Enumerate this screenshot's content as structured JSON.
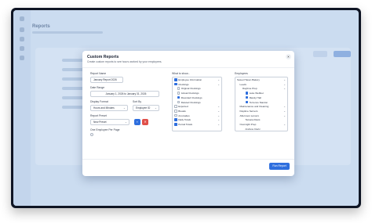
{
  "background": {
    "page_title": "Reports"
  },
  "dialog": {
    "title": "Custom Reports",
    "subtitle": "Create custom reports to see hours worked by your employees.",
    "close_glyph": "×",
    "report_name": {
      "label": "Report Name",
      "value": "January Report 2026"
    },
    "date_range": {
      "label": "Date Range",
      "value": "January 1, 2026 to January 31, 2026"
    },
    "display_format": {
      "label": "Display Format",
      "value": "Hours and Minutes"
    },
    "sort_by": {
      "label": "Sort By",
      "value": "Employee ID"
    },
    "report_preset": {
      "label": "Report Preset",
      "value": "New Preset"
    },
    "one_employee_per_page": {
      "label": "One Employee Per Page",
      "checked": false
    },
    "what_to_show": {
      "label": "What to show...",
      "items": [
        {
          "label": "Employee Information",
          "checked": true,
          "indent": 0,
          "expandable": true
        },
        {
          "label": "Clockings",
          "checked": true,
          "indent": 0,
          "expandable": true
        },
        {
          "label": "Original Clockings",
          "checked": false,
          "indent": 1,
          "expandable": false
        },
        {
          "label": "Actual Clockings",
          "checked": false,
          "indent": 1,
          "expandable": false
        },
        {
          "label": "Rounded Clockings",
          "checked": true,
          "indent": 1,
          "expandable": false
        },
        {
          "label": "Deleted Clockings",
          "checked": false,
          "indent": 1,
          "expandable": false
        },
        {
          "label": "Exported",
          "checked": false,
          "indent": 0,
          "expandable": true
        },
        {
          "label": "Breaks",
          "checked": false,
          "indent": 0,
          "expandable": true
        },
        {
          "label": "Anomalies",
          "checked": false,
          "indent": 0,
          "expandable": true
        },
        {
          "label": "Daily Totals",
          "checked": true,
          "indent": 0,
          "expandable": true
        },
        {
          "label": "Period Totals",
          "checked": true,
          "indent": 0,
          "expandable": true
        }
      ]
    },
    "employees": {
      "label": "Employees",
      "items": [
        {
          "label": "Sweet Haven Bakery",
          "checkbox": null,
          "indent": 0,
          "expandable": true
        },
        {
          "label": "Leeds",
          "checkbox": null,
          "indent": 1,
          "expandable": true
        },
        {
          "label": "Daytime Prep",
          "checkbox": null,
          "indent": 2,
          "expandable": true
        },
        {
          "label": "Luke Webber",
          "checkbox": true,
          "indent": 3,
          "expandable": false
        },
        {
          "label": "Randy Hall",
          "checkbox": true,
          "indent": 3,
          "expandable": false
        },
        {
          "label": "Terrence Stanton",
          "checkbox": true,
          "indent": 3,
          "expandable": false
        },
        {
          "label": "Maintenance and Cleaning",
          "checkbox": null,
          "indent": 1,
          "expandable": true
        },
        {
          "label": "Daytime Servers",
          "checkbox": null,
          "indent": 1,
          "expandable": true
        },
        {
          "label": "Afternoon servers",
          "checkbox": null,
          "indent": 1,
          "expandable": true
        },
        {
          "label": "Tamara Davis",
          "checkbox": null,
          "indent": 3,
          "expandable": false
        },
        {
          "label": "Overnight Prep",
          "checkbox": null,
          "indent": 1,
          "expandable": true
        },
        {
          "label": "Andrew Cleric",
          "checkbox": null,
          "indent": 3,
          "expandable": false
        }
      ]
    },
    "run_button": "Run Report"
  },
  "colors": {
    "accent": "#2f6fde",
    "pdf": "#e0504a"
  },
  "icons": {
    "preset_save": "save-icon",
    "preset_delete": "delete-icon"
  }
}
